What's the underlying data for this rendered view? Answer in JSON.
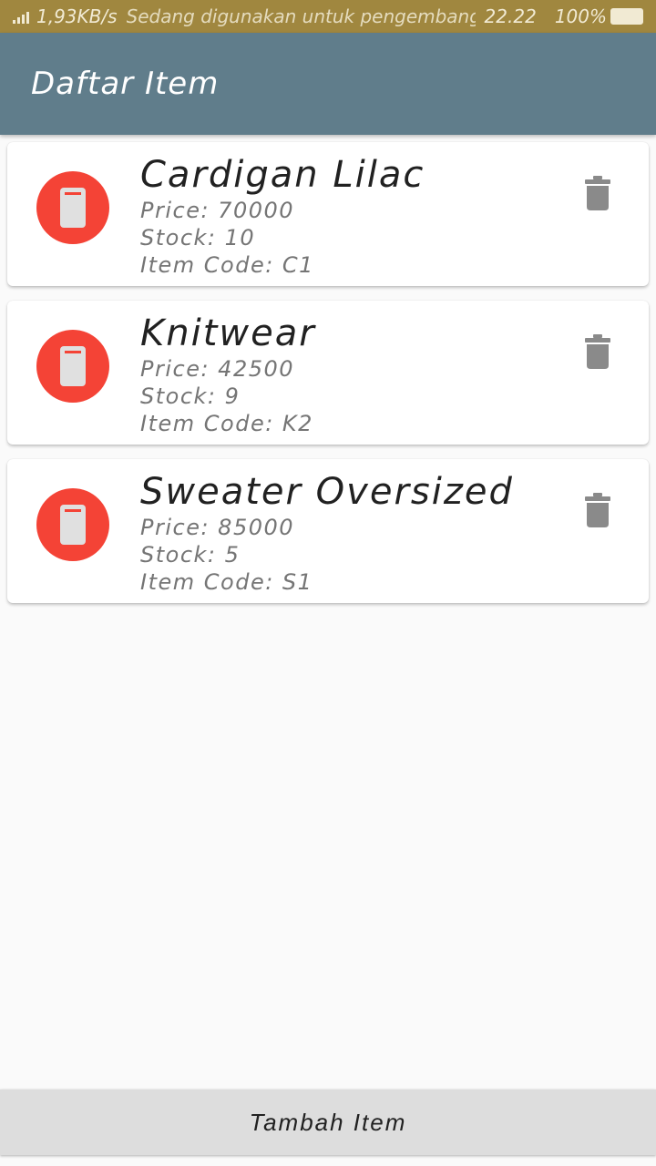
{
  "status_bar": {
    "left_text": "1,93KB/s",
    "ticker": "Sedang digunakan untuk pengembangan, ketuk untuk menutup",
    "time": "22.22",
    "battery": "100%"
  },
  "app_bar": {
    "title": "Daftar Item"
  },
  "items": [
    {
      "name": "Cardigan Lilac",
      "price": "Price: 70000",
      "stock": "Stock: 10",
      "code": "Item Code: C1"
    },
    {
      "name": "Knitwear",
      "price": "Price: 42500",
      "stock": "Stock: 9",
      "code": "Item Code: K2"
    },
    {
      "name": "Sweater Oversized",
      "price": "Price: 85000",
      "stock": "Stock: 5",
      "code": "Item Code: S1"
    }
  ],
  "icons": {
    "avatar": "phone-icon",
    "delete": "trash-icon"
  },
  "colors": {
    "app_bar": "#607d8b",
    "avatar": "#f44336",
    "status_bar": "#a0873f",
    "delete_icon": "#8a8a8a"
  },
  "footer": {
    "add_button_label": "Tambah Item"
  }
}
